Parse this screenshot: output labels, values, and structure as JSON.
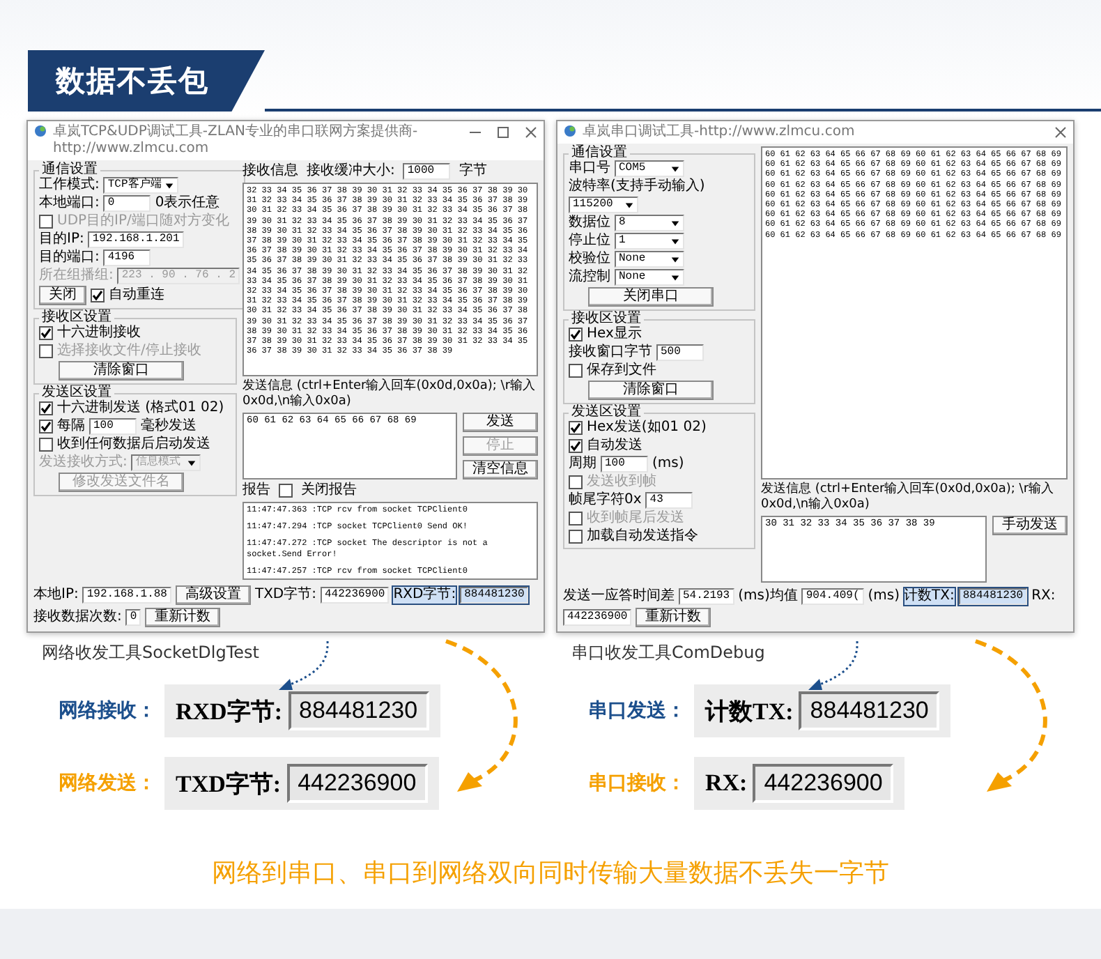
{
  "banner": {
    "title": "数据不丢包"
  },
  "windows": [
    {
      "kind": "socket",
      "title": "卓岚TCP&UDP调试工具-ZLAN专业的串口联网方案提供商-http://www.zlmcu.com",
      "window_buttons": [
        {
          "kind": "minimize"
        },
        {
          "kind": "maximize"
        },
        {
          "kind": "close"
        }
      ],
      "groups": [
        {
          "legend": "通信设置",
          "rows": [
            {
              "kind": "select",
              "label": "工作模式:",
              "value": "TCP客户端",
              "disabled": false
            },
            {
              "kind": "field",
              "label": "本地端口:",
              "value": "0",
              "note": "0表示任意",
              "disabled": false
            },
            {
              "kind": "check",
              "label": "UDP目的IP/端口随对方变化",
              "checked": false,
              "disabled": true
            },
            {
              "kind": "field",
              "label": "目的IP:",
              "value": "192.168.1.201",
              "disabled": false
            },
            {
              "kind": "field",
              "label": "目的端口:",
              "value": "4196",
              "disabled": false
            },
            {
              "kind": "field",
              "label": "所在组播组:",
              "value": "223 . 90 . 76 . 2",
              "disabled": true
            },
            {
              "kind": "button_check",
              "label": "关闭",
              "check_label": "自动重连",
              "checked": true,
              "disabled": false
            }
          ]
        },
        {
          "legend": "接收区设置",
          "rows": [
            {
              "kind": "check",
              "label": "十六进制接收",
              "checked": true,
              "disabled": false
            },
            {
              "kind": "check",
              "label": "选择接收文件/停止接收",
              "checked": false,
              "disabled": true
            },
            {
              "kind": "button",
              "label": "清除窗口",
              "disabled": false
            }
          ]
        },
        {
          "legend": "发送区设置",
          "rows": [
            {
              "kind": "check",
              "label": "十六进制发送 (格式01 02)",
              "checked": true,
              "disabled": false
            },
            {
              "kind": "check_field",
              "label": "每隔",
              "value": "100",
              "note": "毫秒发送",
              "checked": true,
              "disabled": false
            },
            {
              "kind": "check",
              "label": "收到任何数据后启动发送",
              "checked": false,
              "disabled": false
            },
            {
              "kind": "select",
              "label": "发送接收方式:",
              "value": "信息模式",
              "disabled": true
            },
            {
              "kind": "button",
              "label": "修改发送文件名",
              "disabled": true
            }
          ]
        }
      ],
      "receive": {
        "header": [
          {
            "kind": "label",
            "text": "接收信息"
          },
          {
            "kind": "label",
            "text": "接收缓冲大小:"
          },
          {
            "kind": "field",
            "text": "1000"
          },
          {
            "kind": "label",
            "text": "字节"
          }
        ],
        "data": "32 33 34 35 36 37 38 39 30 31 32 33 34 35 36 37 38 39 30 31 32 33 34 35 36 37 38 39 30 31 32 33 34 35 36 37 38 39 30 31 32 33 34 35 36 37 38 39 30 31 32 33 34 35 36 37 38 39 30 31 32 33 34 35 36 37 38 39 30 31 32 33 34 35 36 37 38 39 30 31 32 33 34 35 36 37 38 39 30 31 32 33 34 35 36 37 38 39 30 31 32 33 34 35 36 37 38 39 30 31 32 33 34 35 36 37 38 39 30 31 32 33 34 35 36 37 38 39 30 31 32 33 34 35 36 37 38 39 30 31 32 33 34 35 36 37 38 39 30 31 32 33 34 35 36 37 38 39 30 31 32 33 34 35 36 37 38 39 30 31 32 33 34 35 36 37 38 39 30 31 32 33 34 35 36 37 38 39 30 31 32 33 34 35 36 37 38 39 30 31 32 33 34 35 36 37 38 39 30 31 32 33 34 35 36 37 38 39 30 31 32 33 34 35 36 37 38 39 30 31 32 33 34 35 36 37 38 39 30 31 32 33 34 35 36 37 38 39 30 31 32 33 34 35 36 37 38 39 30 31 32 33 34 35 36 37 38 39 30 31 32 33 34 35 36 37 38 39 30 31 32 33 34 35 36 37 38 39 30 31 32 33 34 35 36 37 38 39 30 31 32 33 34 35 36 37 38 39 30 31 32 33 34 35 36 37 38 39"
      },
      "send": {
        "label": "发送信息 (ctrl+Enter输入回车(0x0d,0x0a); \\r输入0x0d,\\n输入0x0a)",
        "data": "60 61 62 63 64 65 66 67 68 69",
        "buttons": [
          {
            "label": "发送",
            "disabled": false
          },
          {
            "label": "停止",
            "disabled": true
          },
          {
            "label": "清空信息",
            "disabled": false
          }
        ]
      },
      "report": {
        "label": "报告",
        "check_label": "关闭报告",
        "checked": false,
        "lines": [
          "11:47:47.363 :TCP rcv from socket TCPClient0",
          "11:47:47.294 :TCP socket TCPClient0  Send OK!",
          "11:47:47.272 :TCP socket  The descriptor is not a socket.Send Error!",
          "11:47:47.257 :TCP rcv from socket TCPClient0"
        ]
      },
      "status": [
        {
          "kind": "label",
          "text": "本地IP:",
          "highlighted": false
        },
        {
          "kind": "field",
          "text": "192.168.1.88",
          "highlighted": false
        },
        {
          "kind": "button",
          "text": "高级设置",
          "highlighted": false
        },
        {
          "kind": "label",
          "text": "TXD字节:",
          "highlighted": false
        },
        {
          "kind": "field",
          "text": "442236900",
          "highlighted": false
        },
        {
          "kind": "label",
          "text": "RXD字节:",
          "highlighted": true
        },
        {
          "kind": "field",
          "text": "884481230",
          "highlighted": true
        },
        {
          "kind": "label",
          "text": "接收数据次数:",
          "highlighted": false
        },
        {
          "kind": "field",
          "text": "0",
          "highlighted": false
        },
        {
          "kind": "button",
          "text": "重新计数",
          "highlighted": false
        }
      ]
    },
    {
      "kind": "serial",
      "title": "卓岚串口调试工具-http://www.zlmcu.com",
      "window_buttons": [
        {
          "kind": "close"
        }
      ],
      "groups": [
        {
          "legend": "通信设置",
          "rows": [
            {
              "kind": "select",
              "label": "串口号",
              "value": "COM5",
              "disabled": false
            },
            {
              "kind": "text",
              "label": "波特率(支持手动输入)",
              "disabled": false
            },
            {
              "kind": "select",
              "value": "115200",
              "disabled": false
            },
            {
              "kind": "select",
              "label": "数据位",
              "value": "8",
              "disabled": false
            },
            {
              "kind": "select",
              "label": "停止位",
              "value": "1",
              "disabled": false
            },
            {
              "kind": "select",
              "label": "校验位",
              "value": "None",
              "disabled": false
            },
            {
              "kind": "select",
              "label": "流控制",
              "value": "None",
              "disabled": false
            },
            {
              "kind": "button",
              "label": "关闭串口",
              "disabled": false
            }
          ]
        },
        {
          "legend": "接收区设置",
          "rows": [
            {
              "kind": "check",
              "label": "Hex显示",
              "checked": true,
              "disabled": false
            },
            {
              "kind": "field",
              "label": "接收窗口字节",
              "value": "500",
              "disabled": false
            },
            {
              "kind": "check",
              "label": "保存到文件",
              "checked": false,
              "disabled": false
            },
            {
              "kind": "button",
              "label": "清除窗口",
              "disabled": false
            }
          ]
        },
        {
          "legend": "发送区设置",
          "rows": [
            {
              "kind": "check",
              "label": "Hex发送(如01 02)",
              "checked": true,
              "disabled": false
            },
            {
              "kind": "check",
              "label": "自动发送",
              "checked": true,
              "disabled": false
            },
            {
              "kind": "field",
              "label": "周期",
              "value": "100",
              "note": "(ms)",
              "disabled": false
            },
            {
              "kind": "check",
              "label": "发送收到帧",
              "checked": false,
              "disabled": true
            },
            {
              "kind": "field",
              "label": "帧尾字符0x",
              "value": "43",
              "disabled": false
            },
            {
              "kind": "check",
              "label": "收到帧尾后发送",
              "checked": false,
              "disabled": true
            },
            {
              "kind": "check",
              "label": "加载自动发送指令",
              "checked": false,
              "disabled": false
            }
          ]
        }
      ],
      "receive": {
        "data": "60 61 62 63 64 65 66 67 68 69 60 61 62 63 64 65 66 67 68 69 60 61 62 63 64 65 66 67 68 69 60 61 62 63 64 65 66 67 68 69 60 61 62 63 64 65 66 67 68 69 60 61 62 63 64 65 66 67 68 69 60 61 62 63 64 65 66 67 68 69 60 61 62 63 64 65 66 67 68 69 60 61 62 63 64 65 66 67 68 69 60 61 62 63 64 65 66 67 68 69 60 61 62 63 64 65 66 67 68 69 60 61 62 63 64 65 66 67 68 69 60 61 62 63 64 65 66 67 68 69 60 61 62 63 64 65 66 67 68 69 60 61 62 63 64 65 66 67 68 69 60 61 62 63 64 65 66 67 68 69 60 61 62 63 64 65 66 67 68 69 60 61 62 63 64 65 66 67 68 69"
      },
      "send": {
        "label": "发送信息 (ctrl+Enter输入回车(0x0d,0x0a); \\r输入0x0d,\\n输入0x0a)",
        "data": "30 31 32 33 34 35 36 37 38 39",
        "buttons": [
          {
            "label": "手动发送",
            "disabled": false
          }
        ]
      },
      "status": [
        {
          "kind": "label",
          "text": "发送一应答时间差",
          "highlighted": false
        },
        {
          "kind": "field",
          "text": "54.2193",
          "highlighted": false
        },
        {
          "kind": "label",
          "text": "(ms)均值",
          "highlighted": false
        },
        {
          "kind": "field",
          "text": "904.409(",
          "highlighted": false
        },
        {
          "kind": "label",
          "text": "(ms)",
          "highlighted": false
        },
        {
          "kind": "label",
          "text": "计数TX:",
          "highlighted": true
        },
        {
          "kind": "field",
          "text": "884481230",
          "highlighted": true
        },
        {
          "kind": "label",
          "text": "RX:",
          "highlighted": false
        },
        {
          "kind": "field",
          "text": "442236900",
          "highlighted": false
        },
        {
          "kind": "button",
          "text": "重新计数",
          "highlighted": false
        }
      ]
    }
  ],
  "comparisons": [
    {
      "caption": "网络收发工具SocketDlgTest",
      "items": [
        {
          "label": "网络接收：",
          "color": "#1c4f8c",
          "field_label": "RXD字节:",
          "value": "884481230"
        },
        {
          "label": "网络发送：",
          "color": "#f5a000",
          "field_label": "TXD字节:",
          "value": "442236900"
        }
      ]
    },
    {
      "caption": "串口收发工具ComDebug",
      "items": [
        {
          "label": "串口发送：",
          "color": "#1c4f8c",
          "field_label": "计数TX:",
          "value": "884481230"
        },
        {
          "label": "串口接收：",
          "color": "#f5a000",
          "field_label": "RX:",
          "value": "442236900"
        }
      ]
    }
  ],
  "footer": {
    "text": "网络到串口、串口到网络双向同时传输大量数据不丢失一字节"
  }
}
